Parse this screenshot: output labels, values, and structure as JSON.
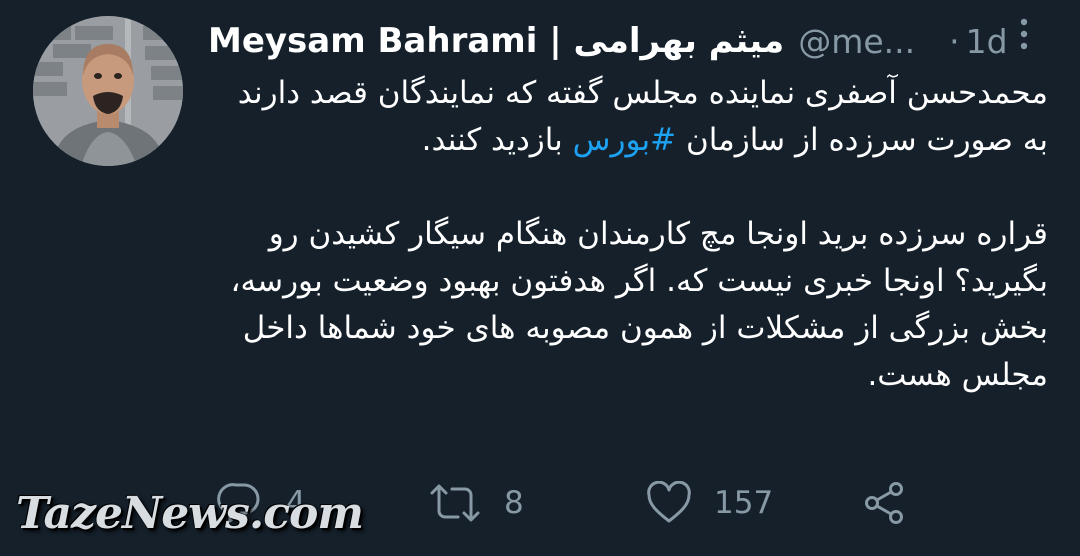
{
  "tweet": {
    "display_name": "Meysam Bahrami | میثم بهرامی",
    "handle": "@me...",
    "separator": "·",
    "time": "1d",
    "body": {
      "p1_before": "محمدحسن آصفری نماینده مجلس گفته که نمایندگان قصد دارند به صورت سرزده از سازمان ",
      "p1_hashtag": "#بورس",
      "p1_after": " بازدید کنند.",
      "p2": "قراره سرزده برید اونجا مچ کارمندان هنگام سیگار کشیدن رو بگیرید؟ اونجا خبری نیست که. اگر هدفتون بهبود وضعیت بورسه، بخش بزرگی از مشکلات از همون مصوبه های خود شماها داخل مجلس هست."
    },
    "actions": {
      "reply": {
        "icon": "reply-icon",
        "count": "4"
      },
      "retweet": {
        "icon": "retweet-icon",
        "count": "8"
      },
      "like": {
        "icon": "heart-icon",
        "count": "157"
      },
      "share": {
        "icon": "share-icon"
      }
    }
  },
  "watermark": "TazeNews.com",
  "colors": {
    "background": "#15202b",
    "text": "#ffffff",
    "muted": "#8899a6",
    "link": "#1da1f2"
  }
}
